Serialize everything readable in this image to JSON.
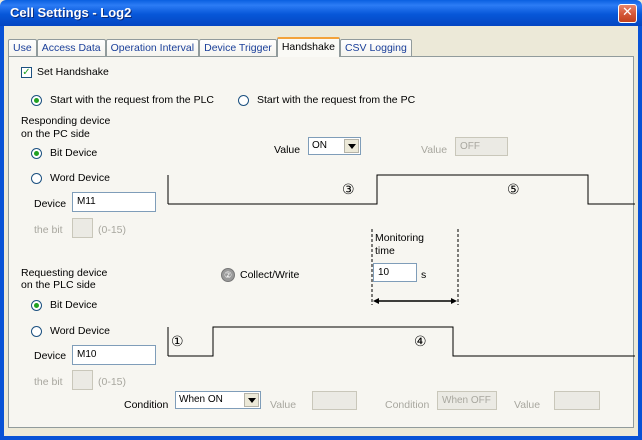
{
  "window": {
    "title": "Cell Settings - Log2",
    "close_glyph": "✕"
  },
  "tabs": [
    {
      "label": "Use"
    },
    {
      "label": "Access Data"
    },
    {
      "label": "Operation Interval"
    },
    {
      "label": "Device Trigger"
    },
    {
      "label": "Handshake"
    },
    {
      "label": "CSV Logging"
    }
  ],
  "active_tab": "Handshake",
  "handshake": {
    "set_handshake_label": "Set Handshake",
    "set_handshake_checked": true,
    "start_plc_label": "Start with the request from the PLC",
    "start_pc_label": "Start with the request from the PC",
    "start_mode": "plc",
    "responding": {
      "heading_line1": "Responding device",
      "heading_line2": "on the PC side",
      "bit_label": "Bit Device",
      "word_label": "Word Device",
      "mode": "bit",
      "device_label": "Device",
      "device_value": "M11",
      "the_bit_label": "the bit",
      "the_bit_value": "",
      "bit_range": "(0-15)",
      "value_label": "Value",
      "value_selected": "ON",
      "value2_label": "Value",
      "value2_value": "OFF"
    },
    "monitoring": {
      "label_line1": "Monitoring",
      "label_line2": "time",
      "value": "10",
      "unit": "s"
    },
    "collect_write": {
      "marker": "②",
      "label": "Collect/Write"
    },
    "requesting": {
      "heading_line1": "Requesting device",
      "heading_line2": "on the PLC side",
      "bit_label": "Bit Device",
      "word_label": "Word Device",
      "mode": "bit",
      "device_label": "Device",
      "device_value": "M10",
      "the_bit_label": "the bit",
      "the_bit_value": "",
      "bit_range": "(0-15)",
      "condition_label": "Condition",
      "condition_selected": "When ON",
      "value_label": "Value",
      "value_value": "",
      "condition2_label": "Condition",
      "condition2_value": "When OFF",
      "value2_label": "Value",
      "value2_value": ""
    },
    "timing_markers": {
      "m1": "①",
      "m3": "③",
      "m4": "④",
      "m5": "⑤"
    }
  },
  "colors": {
    "titlebar": "#0757d8",
    "close_button": "#d55a3a",
    "panel_background": "#f7f6f1",
    "tab_text": "#1a3f9a",
    "active_tab_highlight": "#f3a23a",
    "disabled_text": "#a8a79f"
  }
}
